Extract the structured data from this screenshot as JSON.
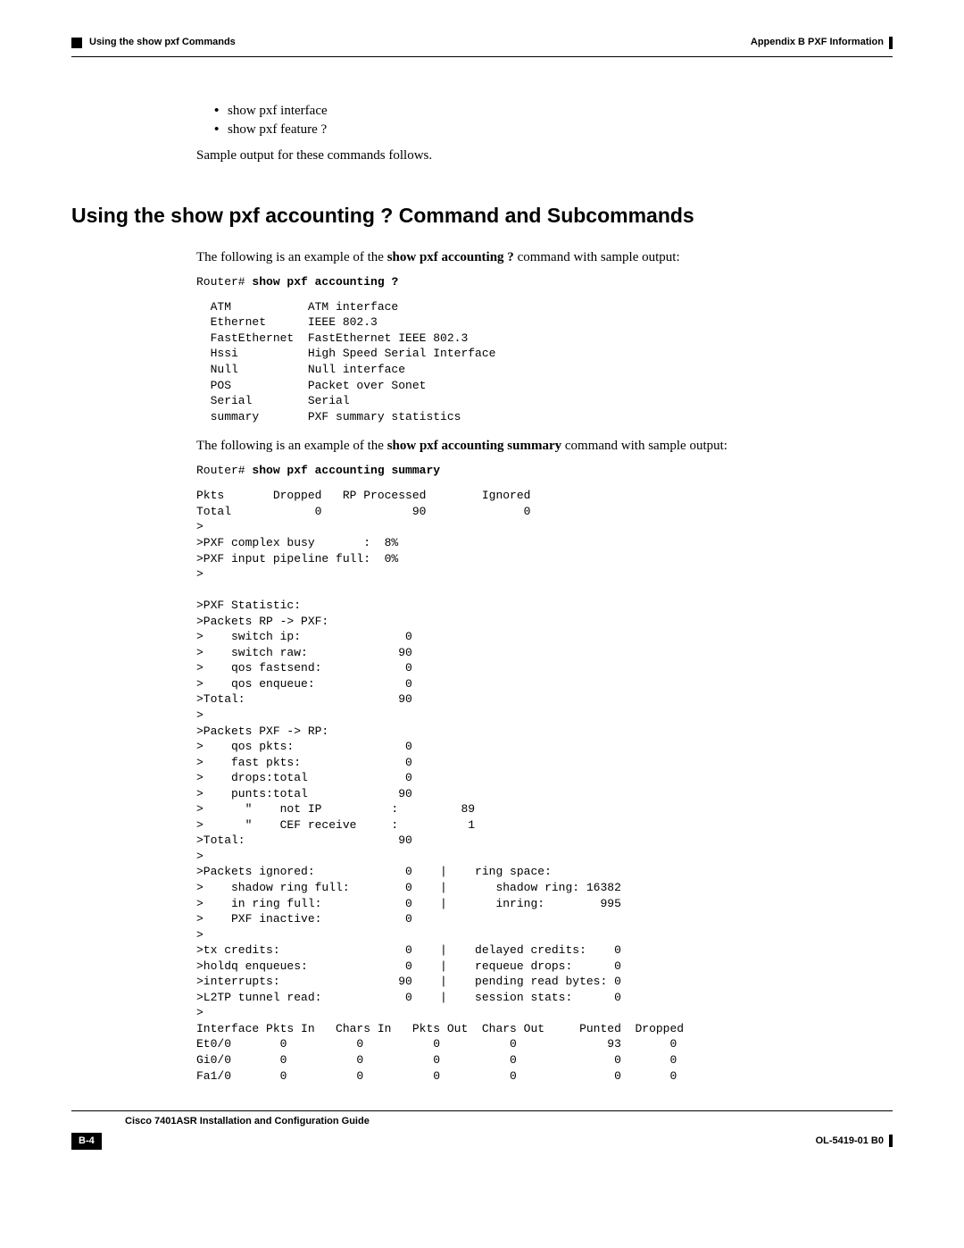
{
  "header": {
    "left": "Using the show pxf Commands",
    "right": "Appendix B    PXF Information"
  },
  "intro": {
    "bullet1": "show pxf interface",
    "bullet2": "show pxf feature ?",
    "sample_line": "Sample output for these commands follows."
  },
  "section_heading": "Using the show pxf accounting ? Command and Subcommands",
  "para1_a": "The following is an example of the ",
  "para1_cmd": "show pxf accounting ?",
  "para1_b": " command with sample output:",
  "prompt1_a": "Router# ",
  "prompt1_b": "show pxf accounting ?",
  "output1": "  ATM           ATM interface\n  Ethernet      IEEE 802.3\n  FastEthernet  FastEthernet IEEE 802.3\n  Hssi          High Speed Serial Interface\n  Null          Null interface\n  POS           Packet over Sonet\n  Serial        Serial\n  summary       PXF summary statistics",
  "para2_a": "The following is an example of the ",
  "para2_cmd": "show pxf accounting summary",
  "para2_b": " command with sample output:",
  "prompt2_a": "Router# ",
  "prompt2_b": "show pxf accounting summary",
  "output2": "Pkts       Dropped   RP Processed        Ignored\nTotal            0             90              0\n>\n>PXF complex busy       :  8%\n>PXF input pipeline full:  0%\n>\n\n>PXF Statistic:\n>Packets RP -> PXF:\n>    switch ip:               0\n>    switch raw:             90\n>    qos fastsend:            0\n>    qos enqueue:             0\n>Total:                      90\n>\n>Packets PXF -> RP:\n>    qos pkts:                0\n>    fast pkts:               0\n>    drops:total              0\n>    punts:total             90\n>      \"    not IP          :         89\n>      \"    CEF receive     :          1\n>Total:                      90\n>\n>Packets ignored:             0    |    ring space:\n>    shadow ring full:        0    |       shadow ring: 16382\n>    in ring full:            0    |       inring:        995\n>    PXF inactive:            0\n>\n>tx credits:                  0    |    delayed credits:    0\n>holdq enqueues:              0    |    requeue drops:      0\n>interrupts:                 90    |    pending read bytes: 0\n>L2TP tunnel read:            0    |    session stats:      0\n>\nInterface Pkts In   Chars In   Pkts Out  Chars Out     Punted  Dropped\nEt0/0       0          0          0          0             93       0\nGi0/0       0          0          0          0              0       0\nFa1/0       0          0          0          0              0       0",
  "footer": {
    "guide": "Cisco 7401ASR Installation and Configuration Guide",
    "page": "B-4",
    "docid": "OL-5419-01 B0"
  }
}
